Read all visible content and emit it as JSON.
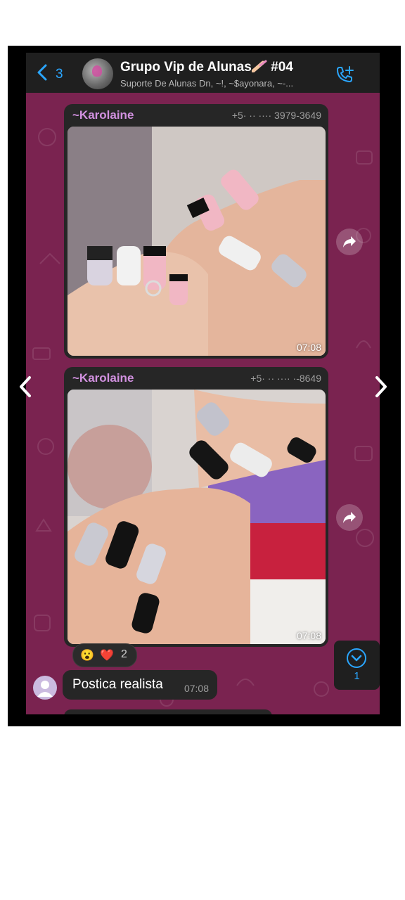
{
  "header": {
    "back_count": "3",
    "title": "Grupo Vip de Alunas",
    "title_suffix": "#04",
    "subtitle": "Suporte De Alunas Dn, ~!, ~$ayonara, ~-..."
  },
  "messages": [
    {
      "sender": "~Karolaine",
      "phone": "+5· ·· ···· 3979-3649",
      "time": "07:08"
    },
    {
      "sender": "~Karolaine",
      "phone": "+5· ·· ···· ·-8649",
      "time": "07:08"
    }
  ],
  "reactions": {
    "emoji1": "😮",
    "emoji2": "❤️",
    "count": "2"
  },
  "reply": {
    "text": "Postica realista",
    "time": "07:08"
  },
  "scroll_button": {
    "count": "1"
  },
  "colors": {
    "accent": "#2aa6ff",
    "sender": "#d291e0",
    "wallpaper": "#7a2350",
    "bubble": "#262626"
  },
  "icons": [
    "back-chevron-icon",
    "call-add-icon",
    "forward-icon",
    "scroll-down-icon",
    "chevron-left-icon",
    "chevron-right-icon"
  ]
}
